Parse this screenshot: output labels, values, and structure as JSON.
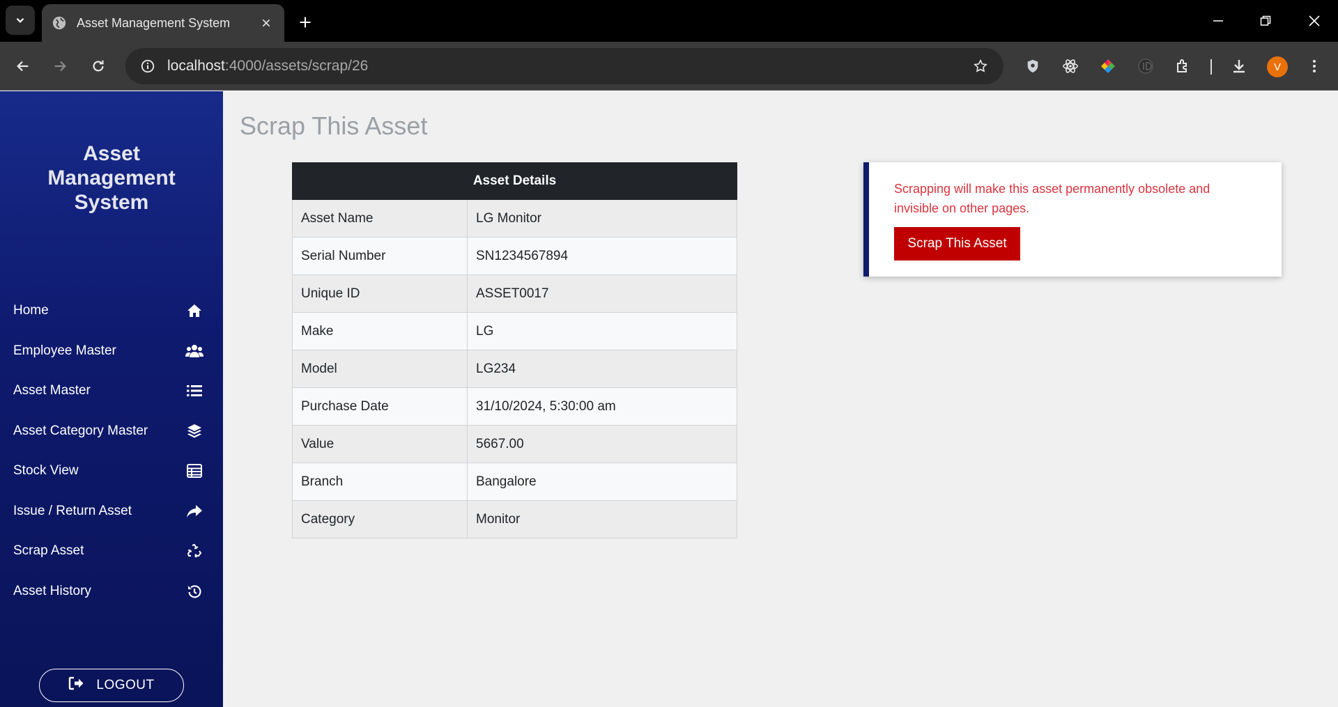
{
  "browser": {
    "tab_title": "Asset Management System",
    "url_host": "localhost",
    "url_path": ":4000/assets/scrap/26",
    "profile_initial": "V"
  },
  "sidebar": {
    "brand_line1": "Asset",
    "brand_line2": "Management",
    "brand_line3": "System",
    "items": [
      {
        "label": "Home",
        "icon": "home-icon"
      },
      {
        "label": "Employee Master",
        "icon": "users-icon"
      },
      {
        "label": "Asset Master",
        "icon": "list-icon"
      },
      {
        "label": "Asset Category Master",
        "icon": "layers-icon"
      },
      {
        "label": "Stock View",
        "icon": "table-icon"
      },
      {
        "label": "Issue / Return Asset",
        "icon": "share-icon"
      },
      {
        "label": "Scrap Asset",
        "icon": "recycle-icon"
      },
      {
        "label": "Asset History",
        "icon": "history-icon"
      }
    ],
    "logout_label": "LOGOUT"
  },
  "main": {
    "title": "Scrap This Asset",
    "table_header": "Asset Details",
    "rows": [
      {
        "label": "Asset Name",
        "value": "LG Monitor"
      },
      {
        "label": "Serial Number",
        "value": "SN1234567894"
      },
      {
        "label": "Unique ID",
        "value": "ASSET0017"
      },
      {
        "label": "Make",
        "value": "LG"
      },
      {
        "label": "Model",
        "value": "LG234"
      },
      {
        "label": "Purchase Date",
        "value": "31/10/2024, 5:30:00 am"
      },
      {
        "label": "Value",
        "value": "5667.00"
      },
      {
        "label": "Branch",
        "value": "Bangalore"
      },
      {
        "label": "Category",
        "value": "Monitor"
      }
    ],
    "warning": "Scrapping will make this asset permanently obsolete and invisible on other pages.",
    "scrap_button": "Scrap This Asset"
  },
  "colors": {
    "sidebar_bg": "#0e1a6e",
    "warning_text": "#d9343e",
    "danger_button": "#c00000",
    "table_header_bg": "#212529"
  }
}
